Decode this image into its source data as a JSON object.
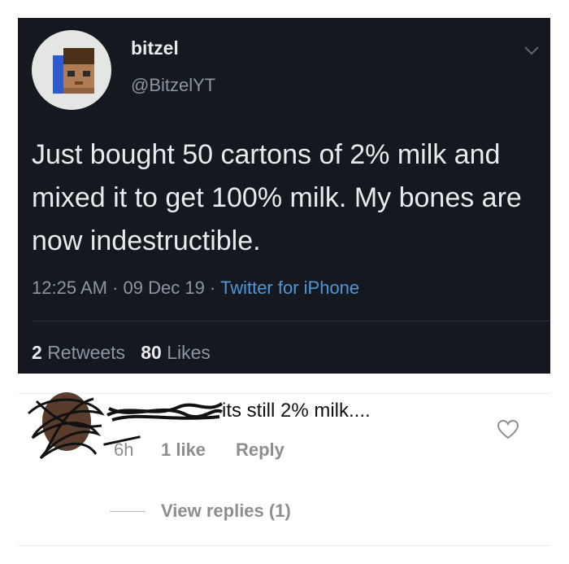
{
  "tweet": {
    "display_name": "bitzel",
    "handle": "@BitzelYT",
    "text": "Just bought 50 cartons of 2% milk and mixed it to get 100% milk. My bones are now indestructible.",
    "time": "12:25 AM",
    "date": "09 Dec 19",
    "source": "Twitter for iPhone",
    "separator": " · ",
    "retweets_count": "2",
    "retweets_label": "Retweets",
    "likes_count": "80",
    "likes_label": "Likes",
    "icons": {
      "menu": "chevron-down-icon",
      "avatar": "minecraft-avatar"
    }
  },
  "comment": {
    "text": "its still 2% milk....",
    "time": "6h",
    "likes": "1 like",
    "reply_label": "Reply",
    "view_replies": "View replies (1)",
    "icons": {
      "like": "heart-icon"
    }
  },
  "colors": {
    "tweet_bg": "#15181f",
    "tweet_text": "#e9eaec",
    "tweet_muted": "#8b96a3",
    "tweet_link": "#4d97da",
    "comment_muted": "#8e8e8e"
  }
}
